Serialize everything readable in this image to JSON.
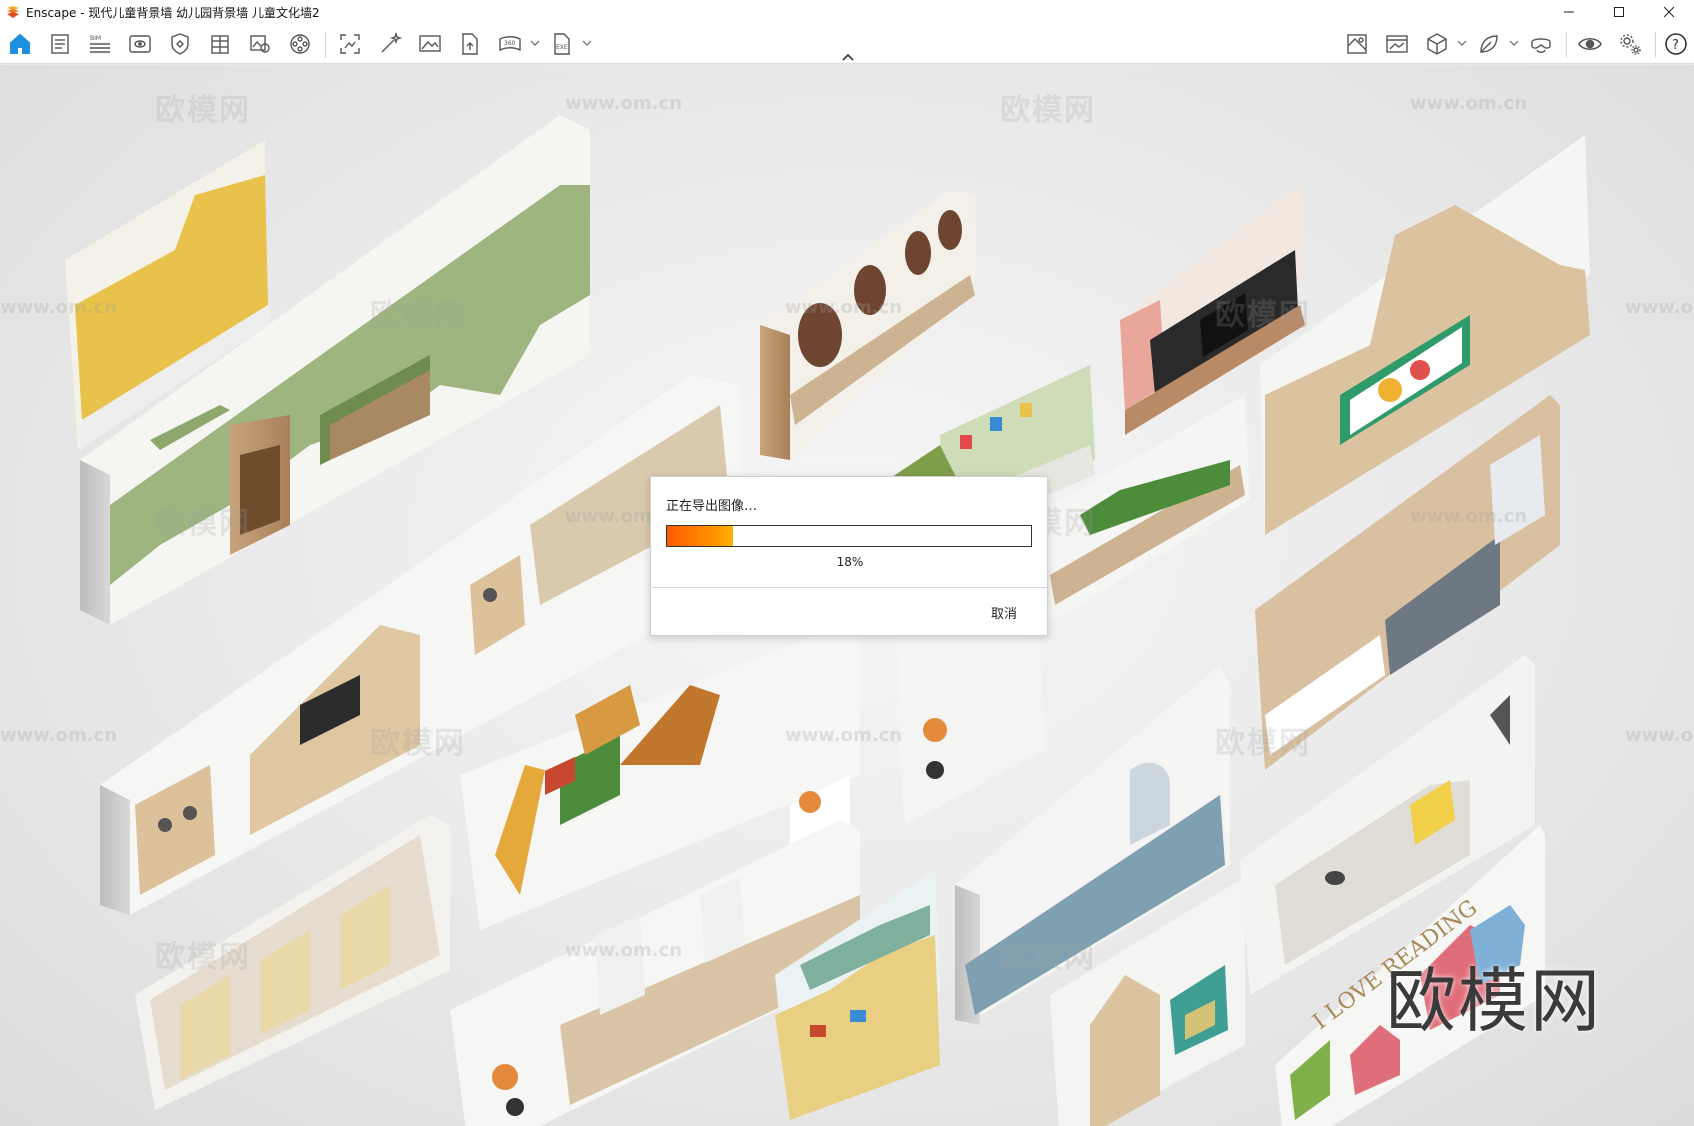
{
  "window": {
    "title": "Enscape - 现代儿童背景墙 幼儿园背景墙 儿童文化墙2",
    "accent": "#f5a623"
  },
  "toolbar": {
    "left_tools": [
      {
        "name": "home-icon",
        "active": true
      },
      {
        "name": "document-icon"
      },
      {
        "name": "bim-icon",
        "label": "BIM"
      },
      {
        "name": "view-icon"
      },
      {
        "name": "shield-icon"
      },
      {
        "name": "building-icon"
      },
      {
        "name": "image-settings-icon"
      },
      {
        "name": "film-reel-icon"
      },
      {
        "name": "screenshot-icon"
      },
      {
        "name": "magic-wand-icon"
      },
      {
        "name": "landscape-image-icon"
      },
      {
        "name": "export-file-icon"
      },
      {
        "name": "panorama-360-icon",
        "label": "360"
      },
      {
        "name": "export-exe-icon",
        "label": "EXE"
      }
    ],
    "right_tools": [
      {
        "name": "material-editor-icon"
      },
      {
        "name": "render-window-icon"
      },
      {
        "name": "cube-icon"
      },
      {
        "name": "leaf-asset-icon"
      },
      {
        "name": "vr-headset-icon"
      },
      {
        "name": "visibility-icon"
      },
      {
        "name": "settings-icon"
      },
      {
        "name": "help-icon",
        "label": "?"
      }
    ]
  },
  "viewport": {
    "watermark_cn": "欧模网",
    "watermark_url": "www.om.cn",
    "watermark_big": "欧模网"
  },
  "dialog": {
    "title": "正在导出图像…",
    "progress_percent": 18,
    "progress_label": "18%",
    "cancel_label": "取消",
    "progress_color": "#ff7a00"
  }
}
